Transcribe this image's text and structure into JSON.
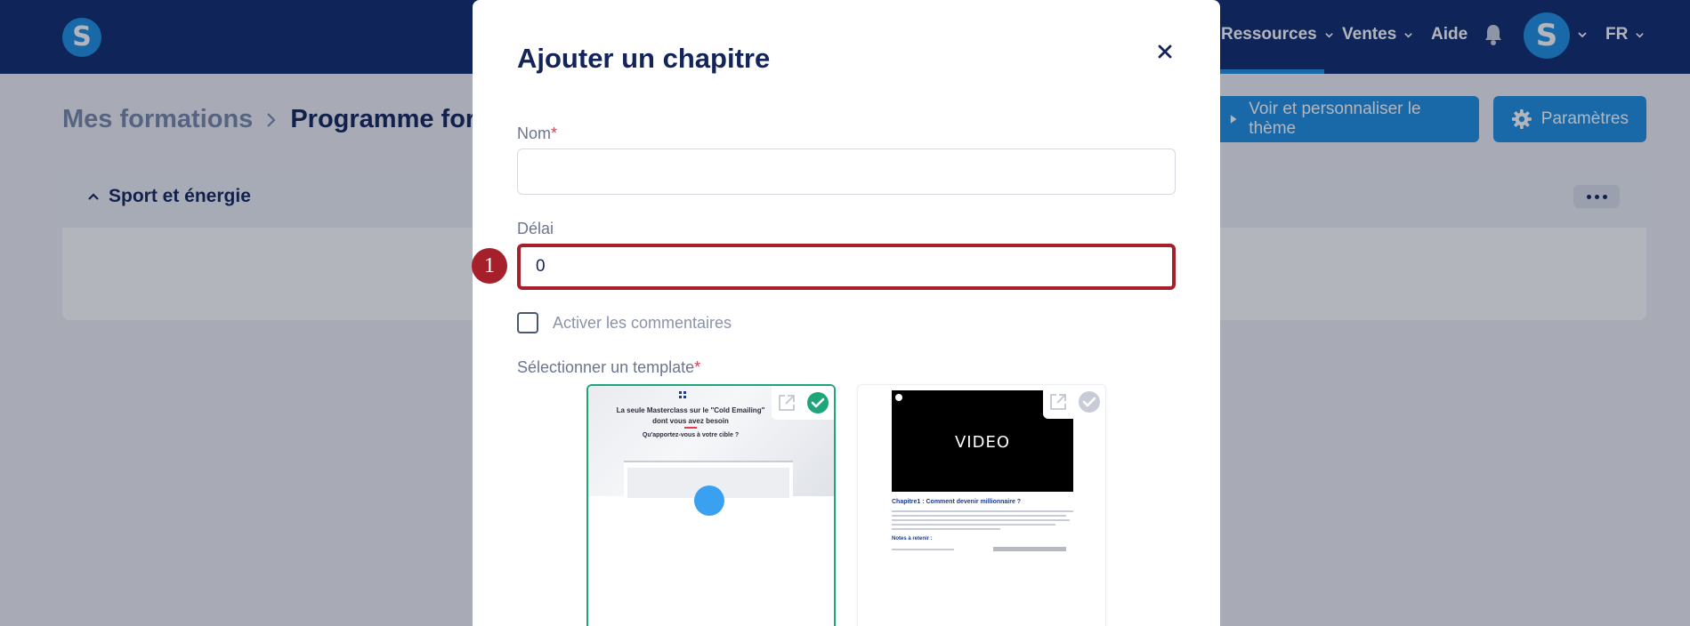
{
  "topbar": {
    "logo_letter": "S",
    "nav": [
      {
        "label": "Ressources"
      },
      {
        "label": "Ventes"
      },
      {
        "label": "Aide"
      }
    ],
    "avatar_letter": "S",
    "language": "FR"
  },
  "page": {
    "breadcrumb": [
      "Mes formations",
      "Programme form"
    ],
    "theme_button": "Voir et personnaliser le thème",
    "settings_button": "Paramètres"
  },
  "section": {
    "title": "Sport et énergie"
  },
  "modal": {
    "title": "Ajouter un chapitre",
    "name_label": "Nom",
    "name_required": "*",
    "name_value": "",
    "delay_label": "Délai",
    "delay_value": "0",
    "step_number": "1",
    "comments_label": "Activer les commentaires",
    "comments_checked": false,
    "template_label": "Sélectionner un template",
    "template_required": "*",
    "templates": [
      {
        "selected": true,
        "hero_text": "La seule Masterclass sur le \"Cold Emailing\" dont vous avez besoin",
        "hero_sub": "Qu'apportez-vous à votre cible ?"
      },
      {
        "selected": false,
        "video_text": "VIDEO",
        "heading": "Chapitre1 : Comment devenir millionnaire ?",
        "subheading": "Notes à retenir :"
      }
    ]
  },
  "colors": {
    "navy": "#0f2a6e",
    "accent_blue": "#1e90e4",
    "focus_red": "#a5202a",
    "selected_green": "#1fa57a"
  }
}
